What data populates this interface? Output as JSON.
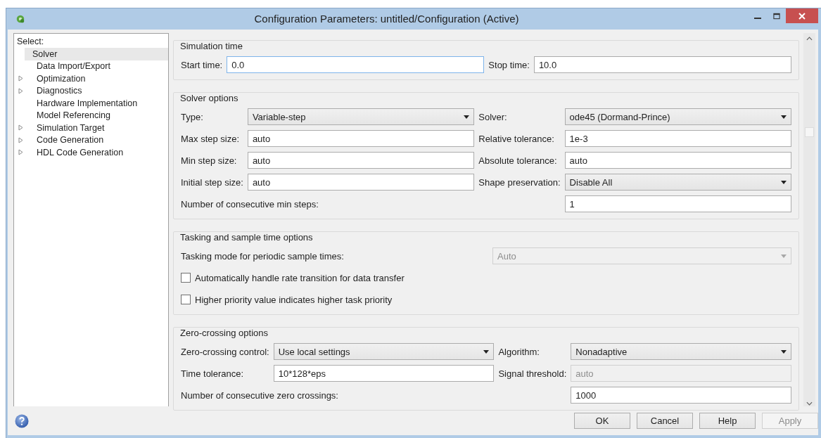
{
  "window": {
    "title": "Configuration Parameters: untitled/Configuration (Active)"
  },
  "sidebar": {
    "header": "Select:",
    "items": [
      {
        "label": "Solver",
        "expandable": false,
        "selected": true
      },
      {
        "label": "Data Import/Export",
        "expandable": false,
        "selected": false
      },
      {
        "label": "Optimization",
        "expandable": true,
        "selected": false
      },
      {
        "label": "Diagnostics",
        "expandable": true,
        "selected": false
      },
      {
        "label": "Hardware Implementation",
        "expandable": false,
        "selected": false
      },
      {
        "label": "Model Referencing",
        "expandable": false,
        "selected": false
      },
      {
        "label": "Simulation Target",
        "expandable": true,
        "selected": false
      },
      {
        "label": "Code Generation",
        "expandable": true,
        "selected": false
      },
      {
        "label": "HDL Code Generation",
        "expandable": true,
        "selected": false
      }
    ]
  },
  "sections": [
    {
      "title": "Simulation time",
      "rows": [
        {
          "kind": "pair",
          "fields": [
            {
              "label": "Start time:",
              "control": {
                "kind": "text",
                "value": "0.0",
                "focused": true,
                "disabled": false
              }
            },
            {
              "label": "Stop time:",
              "control": {
                "kind": "text",
                "value": "10.0",
                "focused": false,
                "disabled": false
              }
            }
          ]
        }
      ]
    },
    {
      "title": "Solver options",
      "rows": [
        {
          "kind": "pair",
          "fields": [
            {
              "label": "Type:",
              "control": {
                "kind": "dropdown",
                "value": "Variable-step",
                "focused": false,
                "disabled": false
              }
            },
            {
              "label": "Solver:",
              "control": {
                "kind": "dropdown",
                "value": "ode45 (Dormand-Prince)",
                "focused": false,
                "disabled": false
              }
            }
          ]
        },
        {
          "kind": "pair",
          "fields": [
            {
              "label": "Max step size:",
              "control": {
                "kind": "text",
                "value": "auto",
                "focused": false,
                "disabled": false
              }
            },
            {
              "label": "Relative tolerance:",
              "control": {
                "kind": "text",
                "value": "1e-3",
                "focused": false,
                "disabled": false
              }
            }
          ]
        },
        {
          "kind": "pair",
          "fields": [
            {
              "label": "Min step size:",
              "control": {
                "kind": "text",
                "value": "auto",
                "focused": false,
                "disabled": false
              }
            },
            {
              "label": "Absolute tolerance:",
              "control": {
                "kind": "text",
                "value": "auto",
                "focused": false,
                "disabled": false
              }
            }
          ]
        },
        {
          "kind": "pair",
          "fields": [
            {
              "label": "Initial step size:",
              "control": {
                "kind": "text",
                "value": "auto",
                "focused": false,
                "disabled": false
              }
            },
            {
              "label": "Shape preservation:",
              "control": {
                "kind": "dropdown",
                "value": "Disable All",
                "focused": false,
                "disabled": false
              }
            }
          ]
        },
        {
          "kind": "wide",
          "label": "Number of consecutive min steps:",
          "control": {
            "kind": "text",
            "value": "1",
            "focused": false,
            "disabled": false
          }
        }
      ]
    },
    {
      "title": "Tasking and sample time options",
      "rows": [
        {
          "kind": "wide",
          "label": "Tasking mode for periodic sample times:",
          "control": {
            "kind": "dropdown",
            "value": "Auto",
            "focused": false,
            "disabled": true
          }
        },
        {
          "kind": "checkbox",
          "label": "Automatically handle rate transition for data transfer",
          "checked": false
        },
        {
          "kind": "checkbox",
          "label": "Higher priority value indicates higher task priority",
          "checked": false
        }
      ]
    },
    {
      "title": "Zero-crossing options",
      "rows": [
        {
          "kind": "pair",
          "fields": [
            {
              "label": "Zero-crossing control:",
              "control": {
                "kind": "dropdown",
                "value": "Use local settings",
                "focused": false,
                "disabled": false
              }
            },
            {
              "label": "Algorithm:",
              "control": {
                "kind": "dropdown",
                "value": "Nonadaptive",
                "focused": false,
                "disabled": false
              }
            }
          ]
        },
        {
          "kind": "pair",
          "fields": [
            {
              "label": "Time tolerance:",
              "control": {
                "kind": "text",
                "value": "10*128*eps",
                "focused": false,
                "disabled": false
              }
            },
            {
              "label": "Signal threshold:",
              "control": {
                "kind": "text",
                "value": "auto",
                "focused": false,
                "disabled": true
              }
            }
          ]
        },
        {
          "kind": "wide",
          "label": "Number of consecutive zero crossings:",
          "control": {
            "kind": "text",
            "value": "1000",
            "focused": false,
            "disabled": false
          }
        }
      ]
    }
  ],
  "buttons": [
    {
      "label": "OK",
      "disabled": false
    },
    {
      "label": "Cancel",
      "disabled": false
    },
    {
      "label": "Help",
      "disabled": false
    },
    {
      "label": "Apply",
      "disabled": true
    }
  ]
}
